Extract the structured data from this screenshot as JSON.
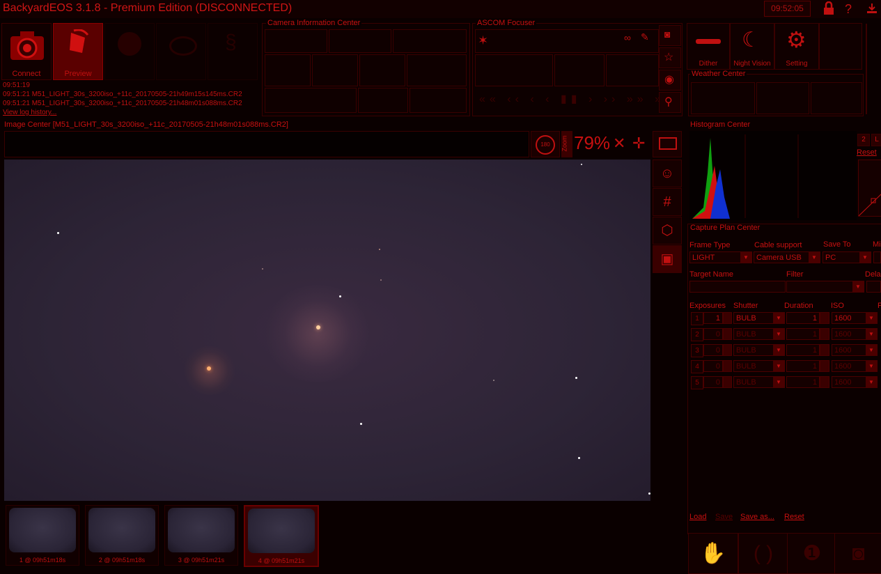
{
  "titlebar": {
    "title": "BackyardEOS 3.1.8  -  Premium Edition (DISCONNECTED)",
    "clock": "09:52:05",
    "icons": [
      "lock-icon",
      "help-icon",
      "download-icon"
    ]
  },
  "toolbar": {
    "connect_label": "Connect",
    "preview_label": "Preview",
    "dither_label": "Dither",
    "night_vision_label": "Night Vision",
    "setting_label": "Setting"
  },
  "log": {
    "lines": [
      "09:51:19",
      "09:51:21 M51_LIGHT_30s_3200iso_+11c_20170505-21h49m15s145ms.CR2",
      "09:51:21 M51_LIGHT_30s_3200iso_+11c_20170505-21h48m01s088ms.CR2"
    ],
    "history_link": "View log history..."
  },
  "panels": {
    "camera_info": "Camera Information Center",
    "focuser": "ASCOM Focuser",
    "weather": "Weather Center",
    "image_center": "Image Center [M51_LIGHT_30s_3200iso_+11c_20170505-21h48m01s088ms.CR2]",
    "histogram": "Histogram Center",
    "capture_plan": "Capture Plan Center"
  },
  "image_tools": {
    "rotate_label": "180",
    "zoom_text": "Zoom",
    "zoom_value": "79%"
  },
  "histogram": {
    "btn_2": "2",
    "btn_l": "L",
    "reset": "Reset"
  },
  "capture": {
    "frame_type_label": "Frame Type",
    "frame_type_value": "LIGHT",
    "cable_label": "Cable support",
    "cable_value": "Camera USB",
    "save_to_label": "Save To",
    "save_to_value": "PC",
    "mi_label": "Mi",
    "target_label": "Target Name",
    "filter_label": "Filter",
    "delay_label": "Dela",
    "exposures_label": "Exposures",
    "shutter_label": "Shutter",
    "duration_label": "Duration",
    "iso_label": "ISO",
    "p_label": "P",
    "rows": [
      {
        "num": "1",
        "count": "1",
        "shutter": "BULB",
        "duration": "1",
        "iso": "1600"
      },
      {
        "num": "2",
        "count": "0",
        "shutter": "BULB",
        "duration": "1",
        "iso": "1600"
      },
      {
        "num": "3",
        "count": "0",
        "shutter": "BULB",
        "duration": "1",
        "iso": "1600"
      },
      {
        "num": "4",
        "count": "0",
        "shutter": "BULB",
        "duration": "1",
        "iso": "1600"
      },
      {
        "num": "5",
        "count": "0",
        "shutter": "BULB",
        "duration": "1",
        "iso": "1600"
      }
    ],
    "load": "Load",
    "save": "Save",
    "save_as": "Save as...",
    "reset": "Reset"
  },
  "thumbnails": [
    {
      "caption": "1 @ 09h51m18s"
    },
    {
      "caption": "2 @ 09h51m18s"
    },
    {
      "caption": "3 @ 09h51m21s"
    },
    {
      "caption": "4 @ 09h51m21s"
    }
  ]
}
